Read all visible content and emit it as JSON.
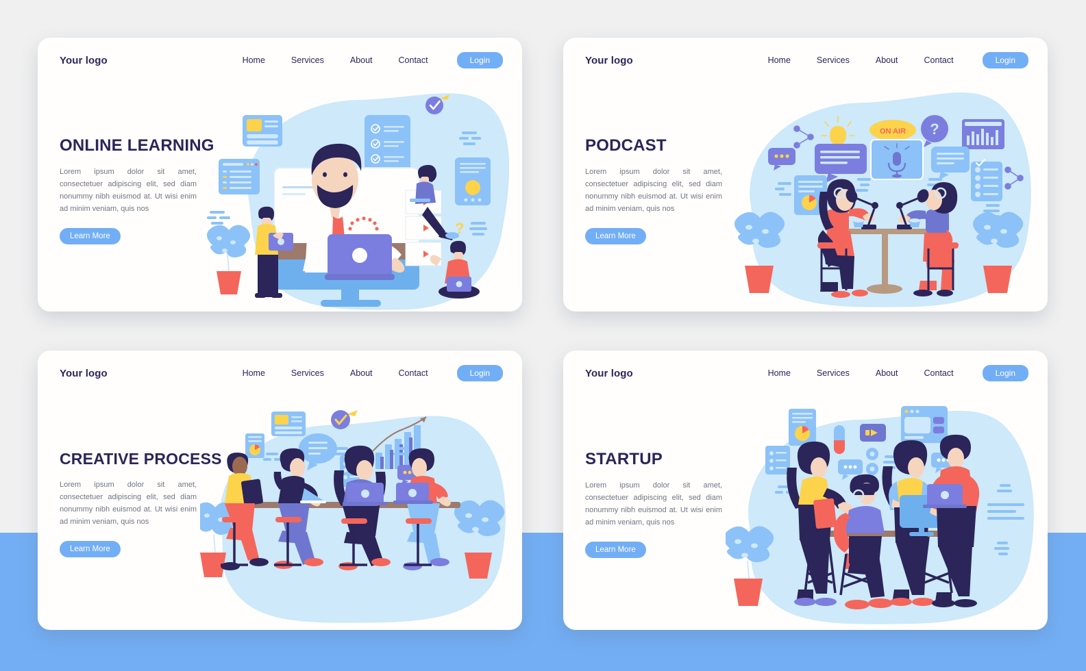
{
  "page": {
    "background_top": "#f0f0f0",
    "background_bottom": "#73aef4",
    "accent_blue": "#72aef5",
    "heading_navy": "#2b2559",
    "body_gray": "#707584",
    "card_bg": "#fffefc",
    "illustration_blob": "#cde9fa",
    "illustration_red": "#f4665b",
    "illustration_yellow": "#fcd34b",
    "illustration_purple": "#7b7ede"
  },
  "shared": {
    "logo": "Your logo",
    "nav": [
      {
        "label": "Home"
      },
      {
        "label": "Services"
      },
      {
        "label": "About"
      },
      {
        "label": "Contact"
      }
    ],
    "login_label": "Login",
    "learn_more_label": "Learn More",
    "body_copy": "Lorem ipsum dolor sit amet, consectetuer adipiscing elit, sed diam nonummy nibh euismod at. Ut wisi enim ad minim veniam, quis nos"
  },
  "cards": [
    {
      "id": "online-learning",
      "headline": "ONLINE LEARNING",
      "illustration": "man-teaching-online-with-monitor-laptop-students",
      "illustration_labels": []
    },
    {
      "id": "podcast",
      "headline": "PODCAST",
      "illustration": "two-people-recording-podcast-with-microphones",
      "illustration_labels": [
        "ON AIR",
        "?"
      ]
    },
    {
      "id": "creative-process",
      "headline": "CREATIVE PROCESS",
      "illustration": "four-people-at-long-desk-with-laptops",
      "illustration_labels": []
    },
    {
      "id": "startup",
      "headline": "STARTUP",
      "illustration": "team-of-four-around-desk-with-devices",
      "illustration_labels": []
    }
  ]
}
